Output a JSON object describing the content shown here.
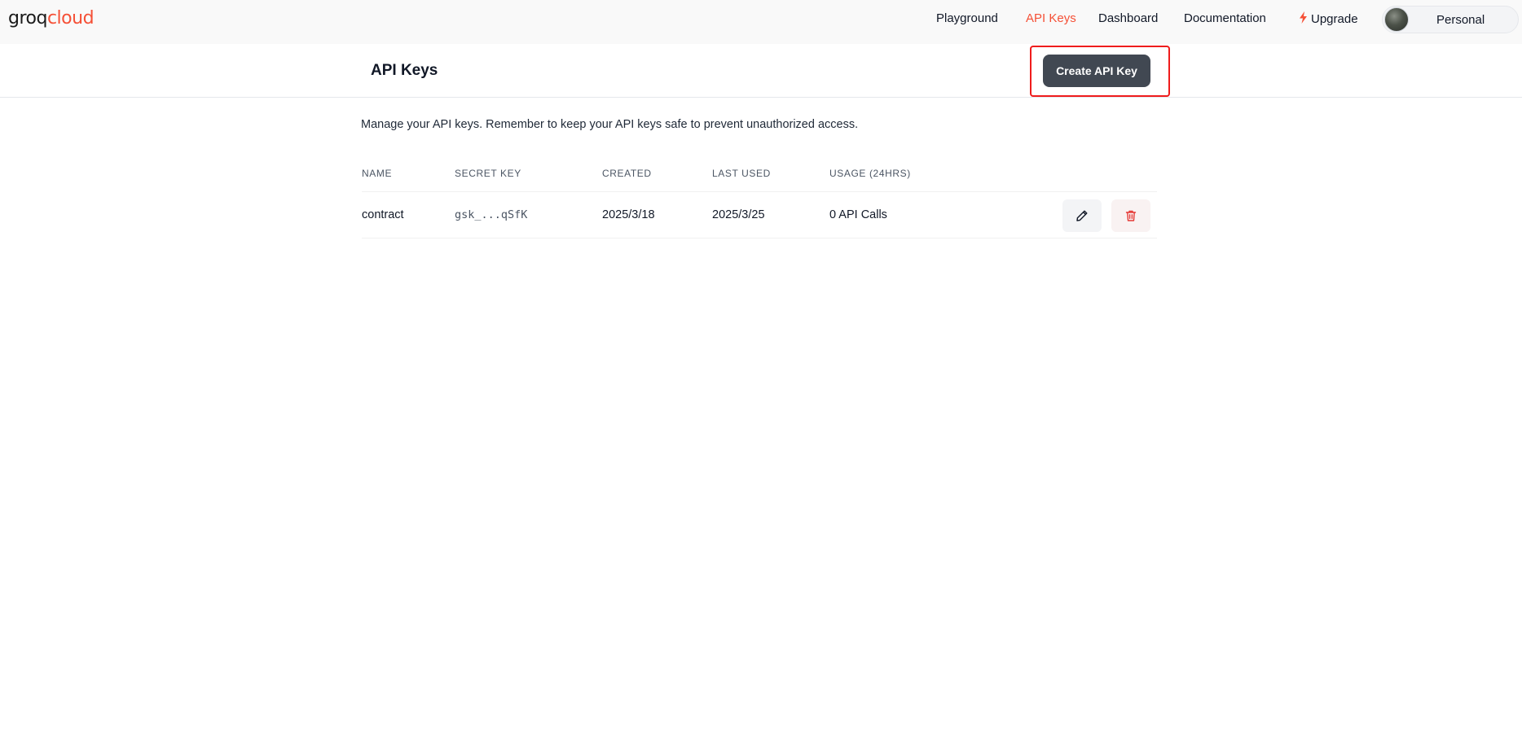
{
  "logo": {
    "part1": "groq",
    "part2": "cloud"
  },
  "nav": {
    "items": [
      {
        "label": "Playground"
      },
      {
        "label": "API Keys"
      },
      {
        "label": "Dashboard"
      },
      {
        "label": "Documentation"
      },
      {
        "label": "Upgrade"
      }
    ],
    "active": "API Keys",
    "org": "Personal"
  },
  "header": {
    "title": "API Keys",
    "create_label": "Create API Key"
  },
  "main": {
    "description": "Manage your API keys. Remember to keep your API keys safe to prevent unauthorized access.",
    "columns": [
      "NAME",
      "SECRET KEY",
      "CREATED",
      "LAST USED",
      "USAGE (24HRS)"
    ],
    "rows": [
      {
        "name": "contract",
        "secret_key": "gsk_...qSfK",
        "created": "2025/3/18",
        "last_used": "2025/3/25",
        "usage": "0 API Calls"
      }
    ]
  },
  "colors": {
    "accent": "#f55036",
    "button_dark": "#414852",
    "highlight": "#ef1c1c",
    "delete": "#e53935"
  },
  "icons": [
    "bolt-icon",
    "pencil-icon",
    "trash-icon"
  ]
}
